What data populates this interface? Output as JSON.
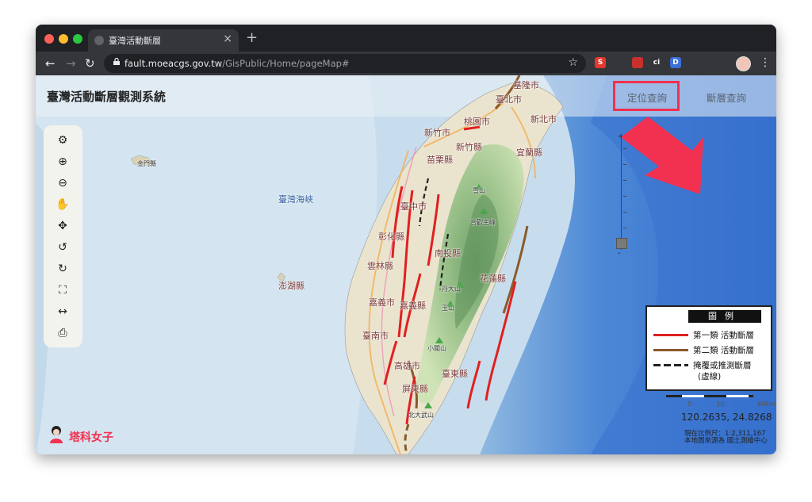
{
  "browser": {
    "tab_title": "臺灣活動斷層",
    "tab_close": "×",
    "new_tab": "+",
    "nav": {
      "back": "←",
      "forward": "→",
      "reload": "↻"
    },
    "url_host": "fault.moeacgs.gov.tw",
    "url_path": "/GisPublic/Home/pageMap#",
    "star": "☆",
    "extensions": [
      {
        "name": "s-extension-icon",
        "label": "S",
        "color": "#e5372b"
      },
      {
        "name": "pocket-icon",
        "label": "",
        "color": "#35363a"
      },
      {
        "name": "bookmark-red-icon",
        "label": "",
        "color": "#c9302c"
      },
      {
        "name": "ci-extension-icon",
        "label": "ci",
        "color": "#35363a"
      },
      {
        "name": "d-extension-icon",
        "label": "D",
        "color": "#3b6fd9"
      },
      {
        "name": "puzzle-icon",
        "label": "",
        "color": "#35363a"
      },
      {
        "name": "cast-icon",
        "label": "",
        "color": "#35363a"
      }
    ],
    "menu": "⋮"
  },
  "header": {
    "title": "臺灣活動斷層觀測系統",
    "nav_locate": "定位查詢",
    "nav_fault": "斷層查詢"
  },
  "toolbar": {
    "tools": [
      {
        "name": "settings-icon",
        "glyph": "⚙"
      },
      {
        "name": "zoom-in-icon",
        "glyph": "⊕"
      },
      {
        "name": "zoom-out-icon",
        "glyph": "⊖"
      },
      {
        "name": "pan-hand-icon",
        "glyph": "✋"
      },
      {
        "name": "move-icon",
        "glyph": "✥"
      },
      {
        "name": "undo-icon",
        "glyph": "↺"
      },
      {
        "name": "redo-icon",
        "glyph": "↻"
      },
      {
        "name": "full-extent-icon",
        "glyph": "⛶"
      },
      {
        "name": "measure-icon",
        "glyph": "↔"
      },
      {
        "name": "print-icon",
        "glyph": "⎙"
      }
    ]
  },
  "zoom_slider": {
    "plus": "+",
    "minus": "-"
  },
  "map": {
    "labels": [
      {
        "text": "基隆市"
      },
      {
        "text": "臺北市"
      },
      {
        "text": "新北市"
      },
      {
        "text": "桃園市"
      },
      {
        "text": "新竹市"
      },
      {
        "text": "新竹縣"
      },
      {
        "text": "宜蘭縣"
      },
      {
        "text": "苗栗縣"
      },
      {
        "text": "金門縣"
      },
      {
        "text": "臺灣海峽"
      },
      {
        "text": "雪山"
      },
      {
        "text": "臺中市"
      },
      {
        "text": "合歡主峰"
      },
      {
        "text": "彰化縣"
      },
      {
        "text": "南投縣"
      },
      {
        "text": "雲林縣"
      },
      {
        "text": "花蓮縣"
      },
      {
        "text": "澎湖縣"
      },
      {
        "text": "嘉義市"
      },
      {
        "text": "嘉義縣"
      },
      {
        "text": "丹大山"
      },
      {
        "text": "玉山"
      },
      {
        "text": "臺南市"
      },
      {
        "text": "小關山"
      },
      {
        "text": "高雄市"
      },
      {
        "text": "臺東縣"
      },
      {
        "text": "屏東縣"
      },
      {
        "text": "北大武山"
      }
    ]
  },
  "legend": {
    "title": "圖例",
    "items": [
      {
        "label": "第一類  活動斷層",
        "color": "#e02020",
        "style": "solid"
      },
      {
        "label": "第二類  活動斷層",
        "color": "#8a5a2b",
        "style": "solid"
      },
      {
        "label": "掩覆或推測斷層",
        "label2": "(虛線)",
        "color": "#222222",
        "style": "dashed"
      }
    ]
  },
  "scale": {
    "ticks": [
      "0",
      "30",
      "60km"
    ]
  },
  "coordinates": "120.2635, 24.8268",
  "scale_info": {
    "line1": "現在比例尺：1:2,311,167",
    "line2": "本地圖來源為 國土測繪中心"
  },
  "brand": {
    "name": "塔科女子"
  }
}
